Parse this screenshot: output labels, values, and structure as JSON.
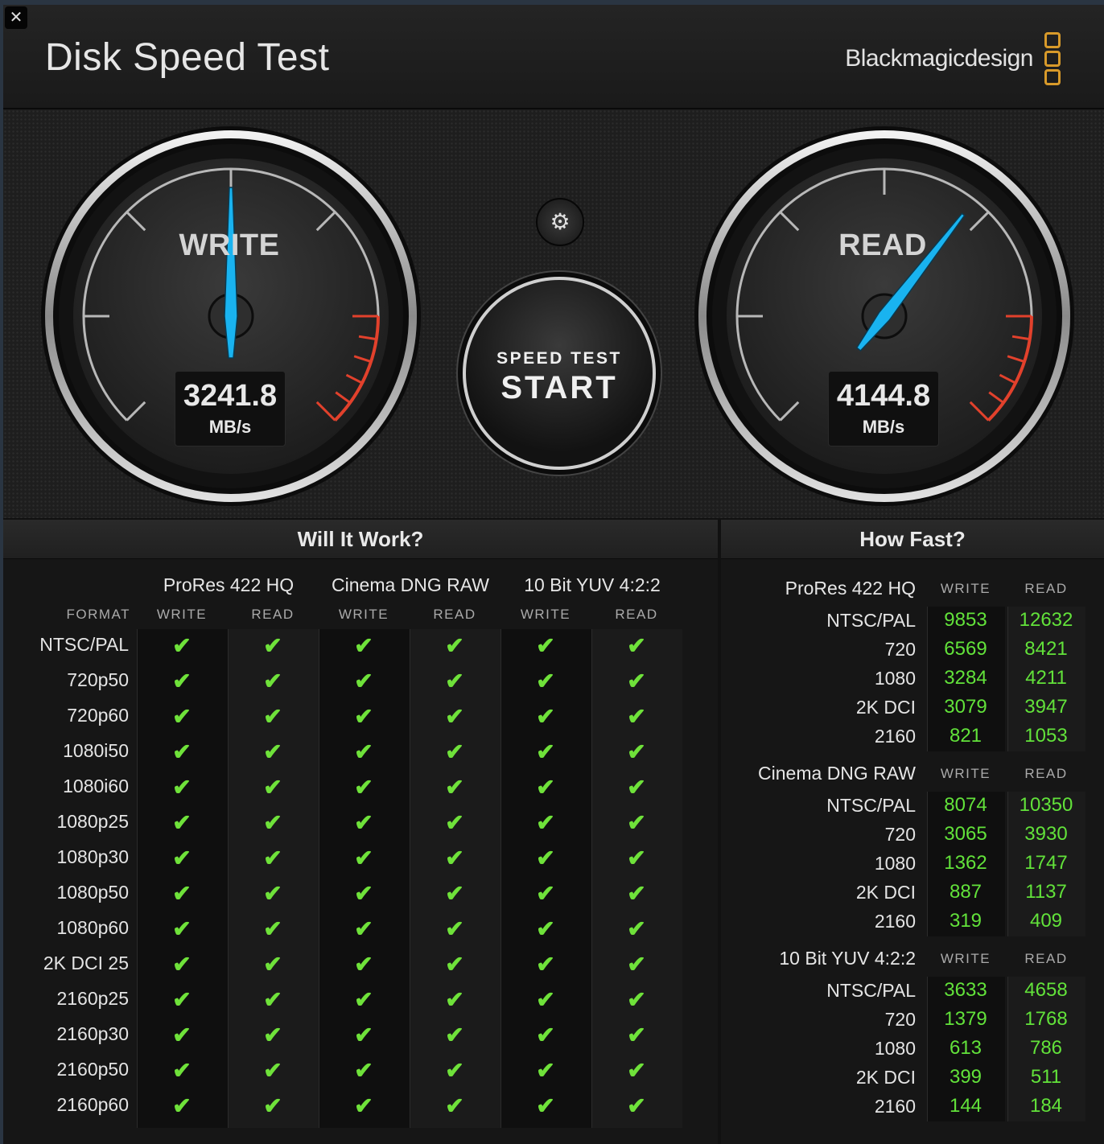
{
  "title_bar": {
    "close_glyph": "✕",
    "app_title": "Disk Speed Test",
    "brand": "Blackmagicdesign"
  },
  "gauges": {
    "write": {
      "label": "WRITE",
      "value": "3241.8",
      "unit": "MB/s",
      "needle_fraction": 0.5
    },
    "read": {
      "label": "READ",
      "value": "4144.8",
      "unit": "MB/s",
      "needle_fraction": 0.64
    }
  },
  "controls": {
    "settings_icon": "gear-icon",
    "start_top": "SPEED TEST",
    "start_main": "START"
  },
  "will_it_work": {
    "title": "Will It Work?",
    "format_label": "FORMAT",
    "codecs": [
      "ProRes 422 HQ",
      "Cinema DNG RAW",
      "10 Bit YUV 4:2:2"
    ],
    "col_labels": [
      "WRITE",
      "READ",
      "WRITE",
      "READ",
      "WRITE",
      "READ"
    ],
    "formats": [
      "NTSC/PAL",
      "720p50",
      "720p60",
      "1080i50",
      "1080i60",
      "1080p25",
      "1080p30",
      "1080p50",
      "1080p60",
      "2K DCI 25",
      "2160p25",
      "2160p30",
      "2160p50",
      "2160p60"
    ],
    "check_glyph": "✔"
  },
  "how_fast": {
    "title": "How Fast?",
    "write_label": "WRITE",
    "read_label": "READ",
    "groups": [
      {
        "codec": "ProRes 422 HQ",
        "rows": [
          {
            "format": "NTSC/PAL",
            "write": "9853",
            "read": "12632"
          },
          {
            "format": "720",
            "write": "6569",
            "read": "8421"
          },
          {
            "format": "1080",
            "write": "3284",
            "read": "4211"
          },
          {
            "format": "2K DCI",
            "write": "3079",
            "read": "3947"
          },
          {
            "format": "2160",
            "write": "821",
            "read": "1053"
          }
        ]
      },
      {
        "codec": "Cinema DNG RAW",
        "rows": [
          {
            "format": "NTSC/PAL",
            "write": "8074",
            "read": "10350"
          },
          {
            "format": "720",
            "write": "3065",
            "read": "3930"
          },
          {
            "format": "1080",
            "write": "1362",
            "read": "1747"
          },
          {
            "format": "2K DCI",
            "write": "887",
            "read": "1137"
          },
          {
            "format": "2160",
            "write": "319",
            "read": "409"
          }
        ]
      },
      {
        "codec": "10 Bit YUV 4:2:2",
        "rows": [
          {
            "format": "NTSC/PAL",
            "write": "3633",
            "read": "4658"
          },
          {
            "format": "720",
            "write": "1379",
            "read": "1768"
          },
          {
            "format": "1080",
            "write": "613",
            "read": "786"
          },
          {
            "format": "2K DCI",
            "write": "399",
            "read": "511"
          },
          {
            "format": "2160",
            "write": "144",
            "read": "184"
          }
        ]
      }
    ]
  },
  "colors": {
    "needle": "#19b3f0",
    "redline": "#e2412c",
    "check": "#6fe23a",
    "value_green": "#62e23a",
    "brand_orange": "#d89a2a"
  }
}
